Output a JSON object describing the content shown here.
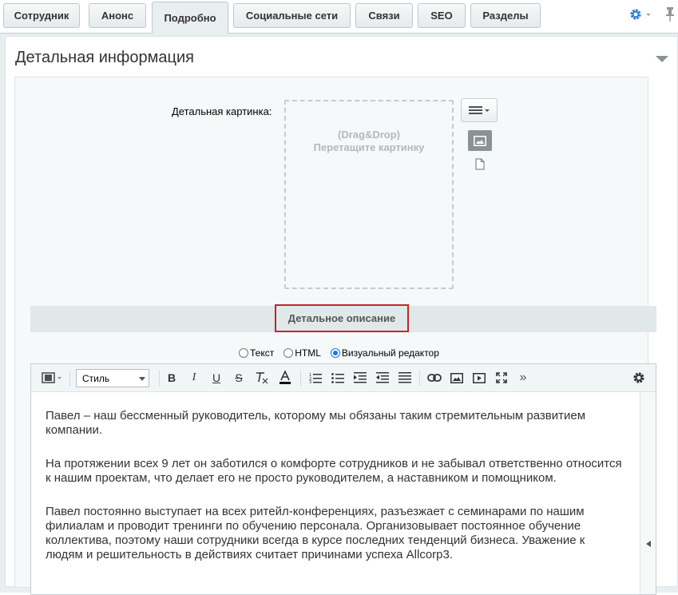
{
  "tabs": [
    {
      "label": "Сотрудник"
    },
    {
      "label": "Анонс"
    },
    {
      "label": "Подробно"
    },
    {
      "label": "Социальные сети"
    },
    {
      "label": "Связи"
    },
    {
      "label": "SEO"
    },
    {
      "label": "Разделы"
    }
  ],
  "active_tab": "Подробно",
  "section": {
    "title": "Детальная информация",
    "picture_label": "Детальная картинка:",
    "dropzone_line1": "(Drag&Drop)",
    "dropzone_line2": "Перетащите картинку"
  },
  "description": {
    "title": "Детальное описание",
    "modes": [
      {
        "label": "Текст",
        "selected": false
      },
      {
        "label": "HTML",
        "selected": false
      },
      {
        "label": "Визуальный редактор",
        "selected": true
      }
    ]
  },
  "editor": {
    "style_select": "Стиль",
    "paragraphs": [
      "Павел – наш бессменный руководитель, которому мы обязаны таким стремительным развитием компании.",
      "На протяжении всех 9 лет он заботился о комфорте сотрудников и не забывал ответственно относится к нашим проектам, что делает его не просто руководителем, а наставником и помощником.",
      "Павел постоянно выступает на всех ритейл-конференциях, разъезжает с семинарами по нашим филиалам и проводит тренинги по обучению персонала. Организовывает постоянное обучение коллектива, поэтому наши сотрудники всегда в курсе последних тенденций бизнеса. Уважение к людям и решительность в действиях считает причинами успеха Allcorp3."
    ]
  },
  "colors": {
    "accent": "#1a73e8",
    "highlight_border": "#c3262b",
    "panel_bg": "#e9eef0"
  }
}
